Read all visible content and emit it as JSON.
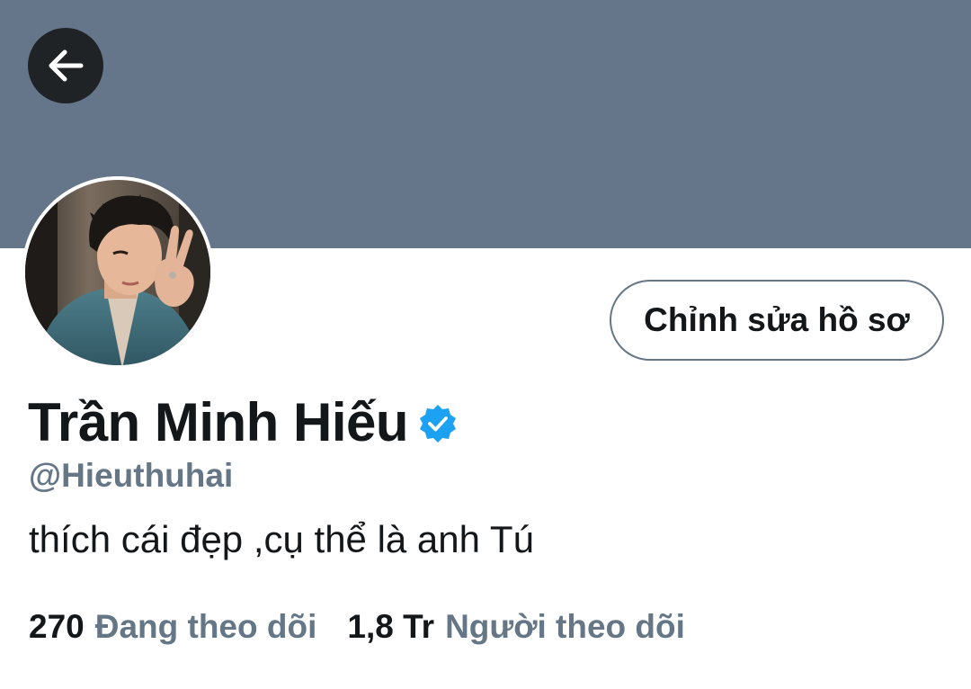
{
  "header": {
    "back_icon": "arrow-left-icon",
    "banner_color": "#66768a"
  },
  "profile": {
    "avatar_icon": "profile-photo",
    "edit_button_label": "Chỉnh sửa hồ sơ",
    "display_name": "Trần Minh Hiếu",
    "verified_icon": "verified-badge-icon",
    "handle": "@Hieuthuhai",
    "bio": "thích cái đẹp ,cụ thể là anh Tú"
  },
  "stats": {
    "following_count": "270",
    "following_label": "Đang theo dõi",
    "followers_count": "1,8 Tr",
    "followers_label": "Người theo dõi"
  },
  "colors": {
    "accent": "#1da1f2",
    "muted_text": "#657786",
    "primary_text": "#14171a"
  }
}
